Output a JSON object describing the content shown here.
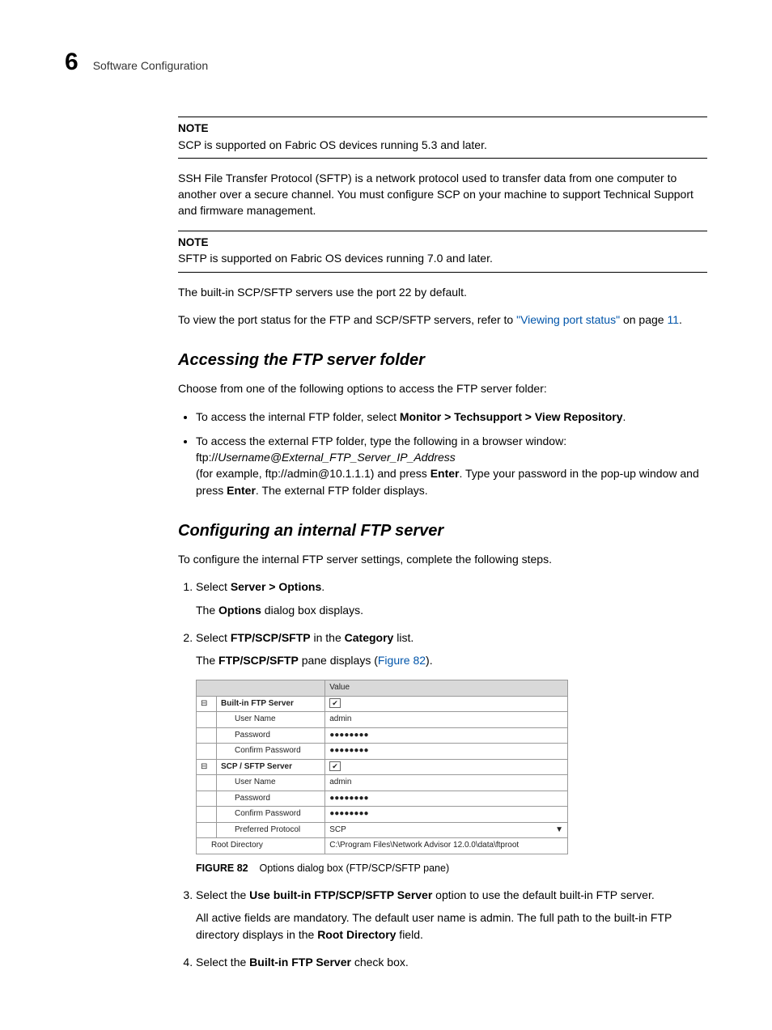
{
  "header": {
    "chapter_number": "6",
    "chapter_title": "Software Configuration"
  },
  "note1": {
    "label": "NOTE",
    "text": "SCP is supported on Fabric OS devices running 5.3 and later."
  },
  "para_sftp": "SSH File Transfer Protocol (SFTP) is a network protocol used to transfer data from one computer to another over a secure channel. You must configure SCP on your machine to support Technical Support and firmware management.",
  "note2": {
    "label": "NOTE",
    "text": "SFTP is supported on Fabric OS devices running 7.0 and later."
  },
  "para_port22": "The built-in SCP/SFTP servers use the port 22 by default.",
  "para_viewport_prefix": "To view the port status for the FTP and SCP/SFTP servers, refer to ",
  "para_viewport_link": "\"Viewing port status\"",
  "para_viewport_suffix1": " on page ",
  "para_viewport_page": "11",
  "para_viewport_suffix2": ".",
  "section1": {
    "title": "Accessing the FTP server folder",
    "intro": "Choose from one of the following options to access the FTP server folder:",
    "bullet1_prefix": "To access the internal FTP folder, select ",
    "bullet1_bold": "Monitor > Techsupport > View Repository",
    "bullet1_suffix": ".",
    "bullet2_a": "To access the external FTP folder, type the following in a browser window: ftp://",
    "bullet2_italic": "Username@External_FTP_Server_IP_Address",
    "bullet2_b": " (for example, ftp://admin@10.1.1.1) and press ",
    "bullet2_bold1": "Enter",
    "bullet2_c": ". Type your password in the pop-up window and press ",
    "bullet2_bold2": "Enter",
    "bullet2_d": ". The external FTP folder displays."
  },
  "section2": {
    "title": "Configuring an internal FTP server",
    "intro": "To configure the internal FTP server settings, complete the following steps.",
    "step1_prefix": "Select ",
    "step1_bold": "Server > Options",
    "step1_suffix": ".",
    "step1_sub_prefix": "The ",
    "step1_sub_bold": "Options",
    "step1_sub_suffix": " dialog box displays.",
    "step2_prefix": "Select ",
    "step2_bold1": "FTP/SCP/SFTP",
    "step2_mid": " in the ",
    "step2_bold2": "Category",
    "step2_suffix": " list.",
    "step2_sub_prefix": "The ",
    "step2_sub_bold": "FTP/SCP/SFTP",
    "step2_sub_mid": " pane displays (",
    "step2_sub_link": "Figure 82",
    "step2_sub_suffix": ").",
    "step3_prefix": "Select the ",
    "step3_bold": "Use built-in FTP/SCP/SFTP Server",
    "step3_suffix": " option to use the default built-in FTP server.",
    "step3_sub_a": "All active fields are mandatory. The default user name is admin. The full path to the built-in FTP directory displays in the ",
    "step3_sub_bold": "Root Directory",
    "step3_sub_b": " field.",
    "step4_prefix": "Select the ",
    "step4_bold": "Built-in FTP Server",
    "step4_suffix": " check box."
  },
  "figure": {
    "header_value": "Value",
    "group1": "Built-in FTP Server",
    "g1_user_label": "User Name",
    "g1_user_val": "admin",
    "g1_pw_label": "Password",
    "g1_pw_val": "●●●●●●●●",
    "g1_cpw_label": "Confirm Password",
    "g1_cpw_val": "●●●●●●●●",
    "group2": "SCP / SFTP Server",
    "g2_user_label": "User Name",
    "g2_user_val": "admin",
    "g2_pw_label": "Password",
    "g2_pw_val": "●●●●●●●●",
    "g2_cpw_label": "Confirm Password",
    "g2_cpw_val": "●●●●●●●●",
    "g2_proto_label": "Preferred Protocol",
    "g2_proto_val": "SCP",
    "root_label": "Root Directory",
    "root_val": "C:\\Program Files\\Network Advisor 12.0.0\\data\\ftproot",
    "checkmark": "✔",
    "expander": "⊟",
    "caption_bold": "FIGURE 82",
    "caption_text": "Options dialog box (FTP/SCP/SFTP pane)"
  }
}
